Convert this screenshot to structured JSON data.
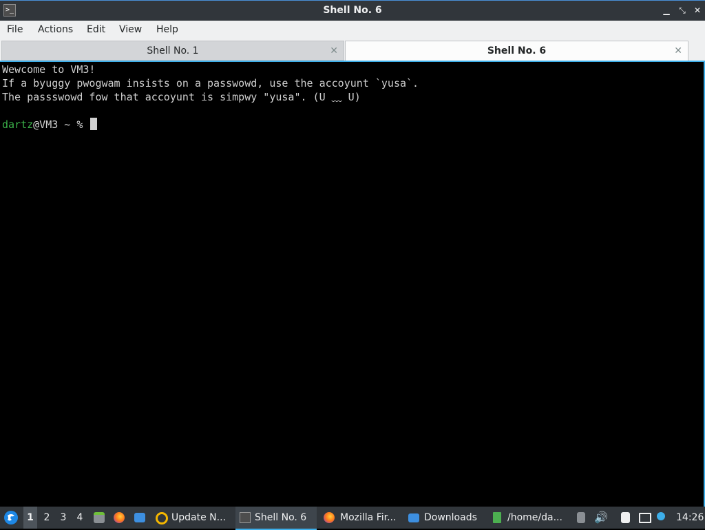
{
  "window": {
    "title": "Shell No. 6",
    "icon": "terminal-icon",
    "controls": [
      "minimize-icon",
      "maximize-icon",
      "close-icon"
    ],
    "control_glyphs": [
      "▁",
      "⤡",
      "✕"
    ]
  },
  "menu": [
    "File",
    "Actions",
    "Edit",
    "View",
    "Help"
  ],
  "tabs": [
    {
      "label": "Shell No. 1",
      "active": false
    },
    {
      "label": "Shell No. 6",
      "active": true
    }
  ],
  "tab_close_glyph": "✕",
  "terminal": {
    "lines": [
      "Wewcome to VM3!",
      "If a byuggy pwogwam insists on a passwowd, use the accoyunt `yusa`.",
      "The passswowd fow that accoyunt is simpwy \"yusa\". (U ﹏ U)"
    ],
    "prompt_user": "dartz",
    "prompt_rest": "@VM3 ~ % ",
    "colors": {
      "user": "#3bb24a",
      "text": "#d0d0d0",
      "background": "#000000"
    }
  },
  "taskbar": {
    "desktops": [
      "1",
      "2",
      "3",
      "4"
    ],
    "active_desktop": "1",
    "launchers": [
      "app-menu-icon",
      "file-manager-icon",
      "firefox-icon",
      "show-desktop-icon"
    ],
    "tasks": [
      {
        "label": "Update N...",
        "icon": "update-notifier-icon"
      },
      {
        "label": "Shell No. 6",
        "icon": "terminal-icon"
      },
      {
        "label": "Mozilla Fir...",
        "icon": "firefox-icon"
      },
      {
        "label": "Downloads",
        "icon": "folder-icon"
      },
      {
        "label": "/home/da...",
        "icon": "archive-icon"
      }
    ],
    "tray": [
      "keyboard-icon",
      "volume-icon",
      "clipboard-icon",
      "network-icon",
      "notification-icon"
    ],
    "clock": "14:26",
    "accent": "#3daee9"
  }
}
